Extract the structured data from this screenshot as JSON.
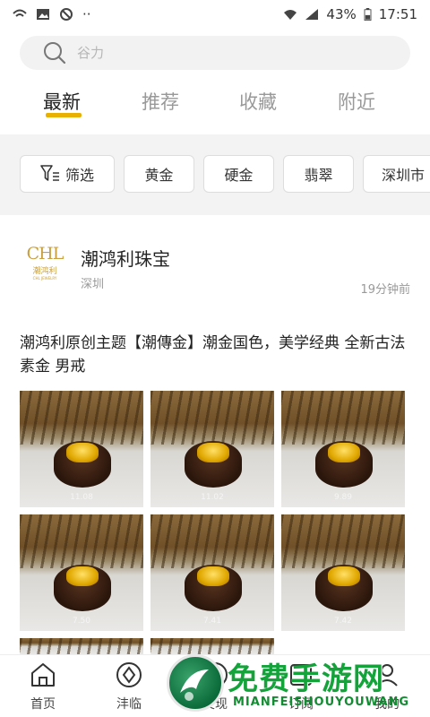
{
  "status_bar": {
    "battery": "43%",
    "time": "17:51",
    "dots": "··"
  },
  "search": {
    "placeholder": "谷力"
  },
  "tabs": [
    {
      "label": "最新",
      "active": true
    },
    {
      "label": "推荐",
      "active": false
    },
    {
      "label": "收藏",
      "active": false
    },
    {
      "label": "附近",
      "active": false
    }
  ],
  "filters": [
    {
      "label": "筛选",
      "icon": "filter-icon"
    },
    {
      "label": "黄金"
    },
    {
      "label": "硬金"
    },
    {
      "label": "翡翠"
    },
    {
      "label": "深圳市"
    }
  ],
  "post": {
    "logo": {
      "monogram": "CHL",
      "name": "潮鸿利",
      "tag": "CHL JEWELRY"
    },
    "shop_name": "潮鸿利珠宝",
    "city": "深圳",
    "time": "19分钟前",
    "text": "潮鸿利原创主题【潮傳金】潮金国色，美学经典 全新古法素金 男戒",
    "photo_captions": [
      "11.08",
      "11.02",
      "9.89",
      "7.50",
      "7.41",
      "7.42",
      "",
      ""
    ]
  },
  "bottom_nav": [
    {
      "label": "首页",
      "icon": "home-icon"
    },
    {
      "label": "沣临",
      "icon": "compass-icon"
    },
    {
      "label": "发现",
      "icon": "discover-icon"
    },
    {
      "label": "订阅",
      "icon": "subscribe-icon"
    },
    {
      "label": "我的",
      "icon": "profile-icon"
    }
  ],
  "watermark": {
    "title": "免费手游网",
    "subtitle": "MIANFEISHOUYOUWANG"
  },
  "colors": {
    "accent": "#e8b100",
    "watermark_green": "#14a33a",
    "filter_bg": "#f3f3f3"
  }
}
